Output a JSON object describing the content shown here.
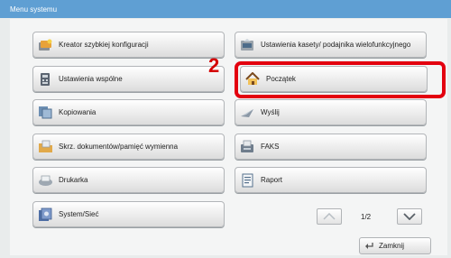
{
  "window": {
    "title": "Menu systemu"
  },
  "buttons": {
    "quick_setup": "Kreator szybkiej konfiguracji",
    "cassette_settings": "Ustawienia kasety/ podajnika wielofunkcyjnego",
    "common_settings": "Ustawienia wspólne",
    "home": "Początek",
    "copy": "Kopiowania",
    "send": "Wyślij",
    "doc_box": "Skrz. dokumentów/pamięć wymienna",
    "fax": "FAKS",
    "printer": "Drukarka",
    "report": "Raport",
    "system_network": "System/Sieć"
  },
  "pager": {
    "page": "1/2"
  },
  "close": {
    "label": "Zamknij"
  },
  "annotation": {
    "step": "2"
  },
  "colors": {
    "title_bar": "#5f9fd3",
    "highlight": "#e3000f"
  },
  "icons": [
    "wizard-icon",
    "cassette-icon",
    "settings-icon",
    "home-icon",
    "copy-icon",
    "send-icon",
    "document-box-icon",
    "fax-icon",
    "printer-icon",
    "report-icon",
    "system-icon",
    "chevron-up-icon",
    "chevron-down-icon",
    "close-arrow-icon"
  ]
}
